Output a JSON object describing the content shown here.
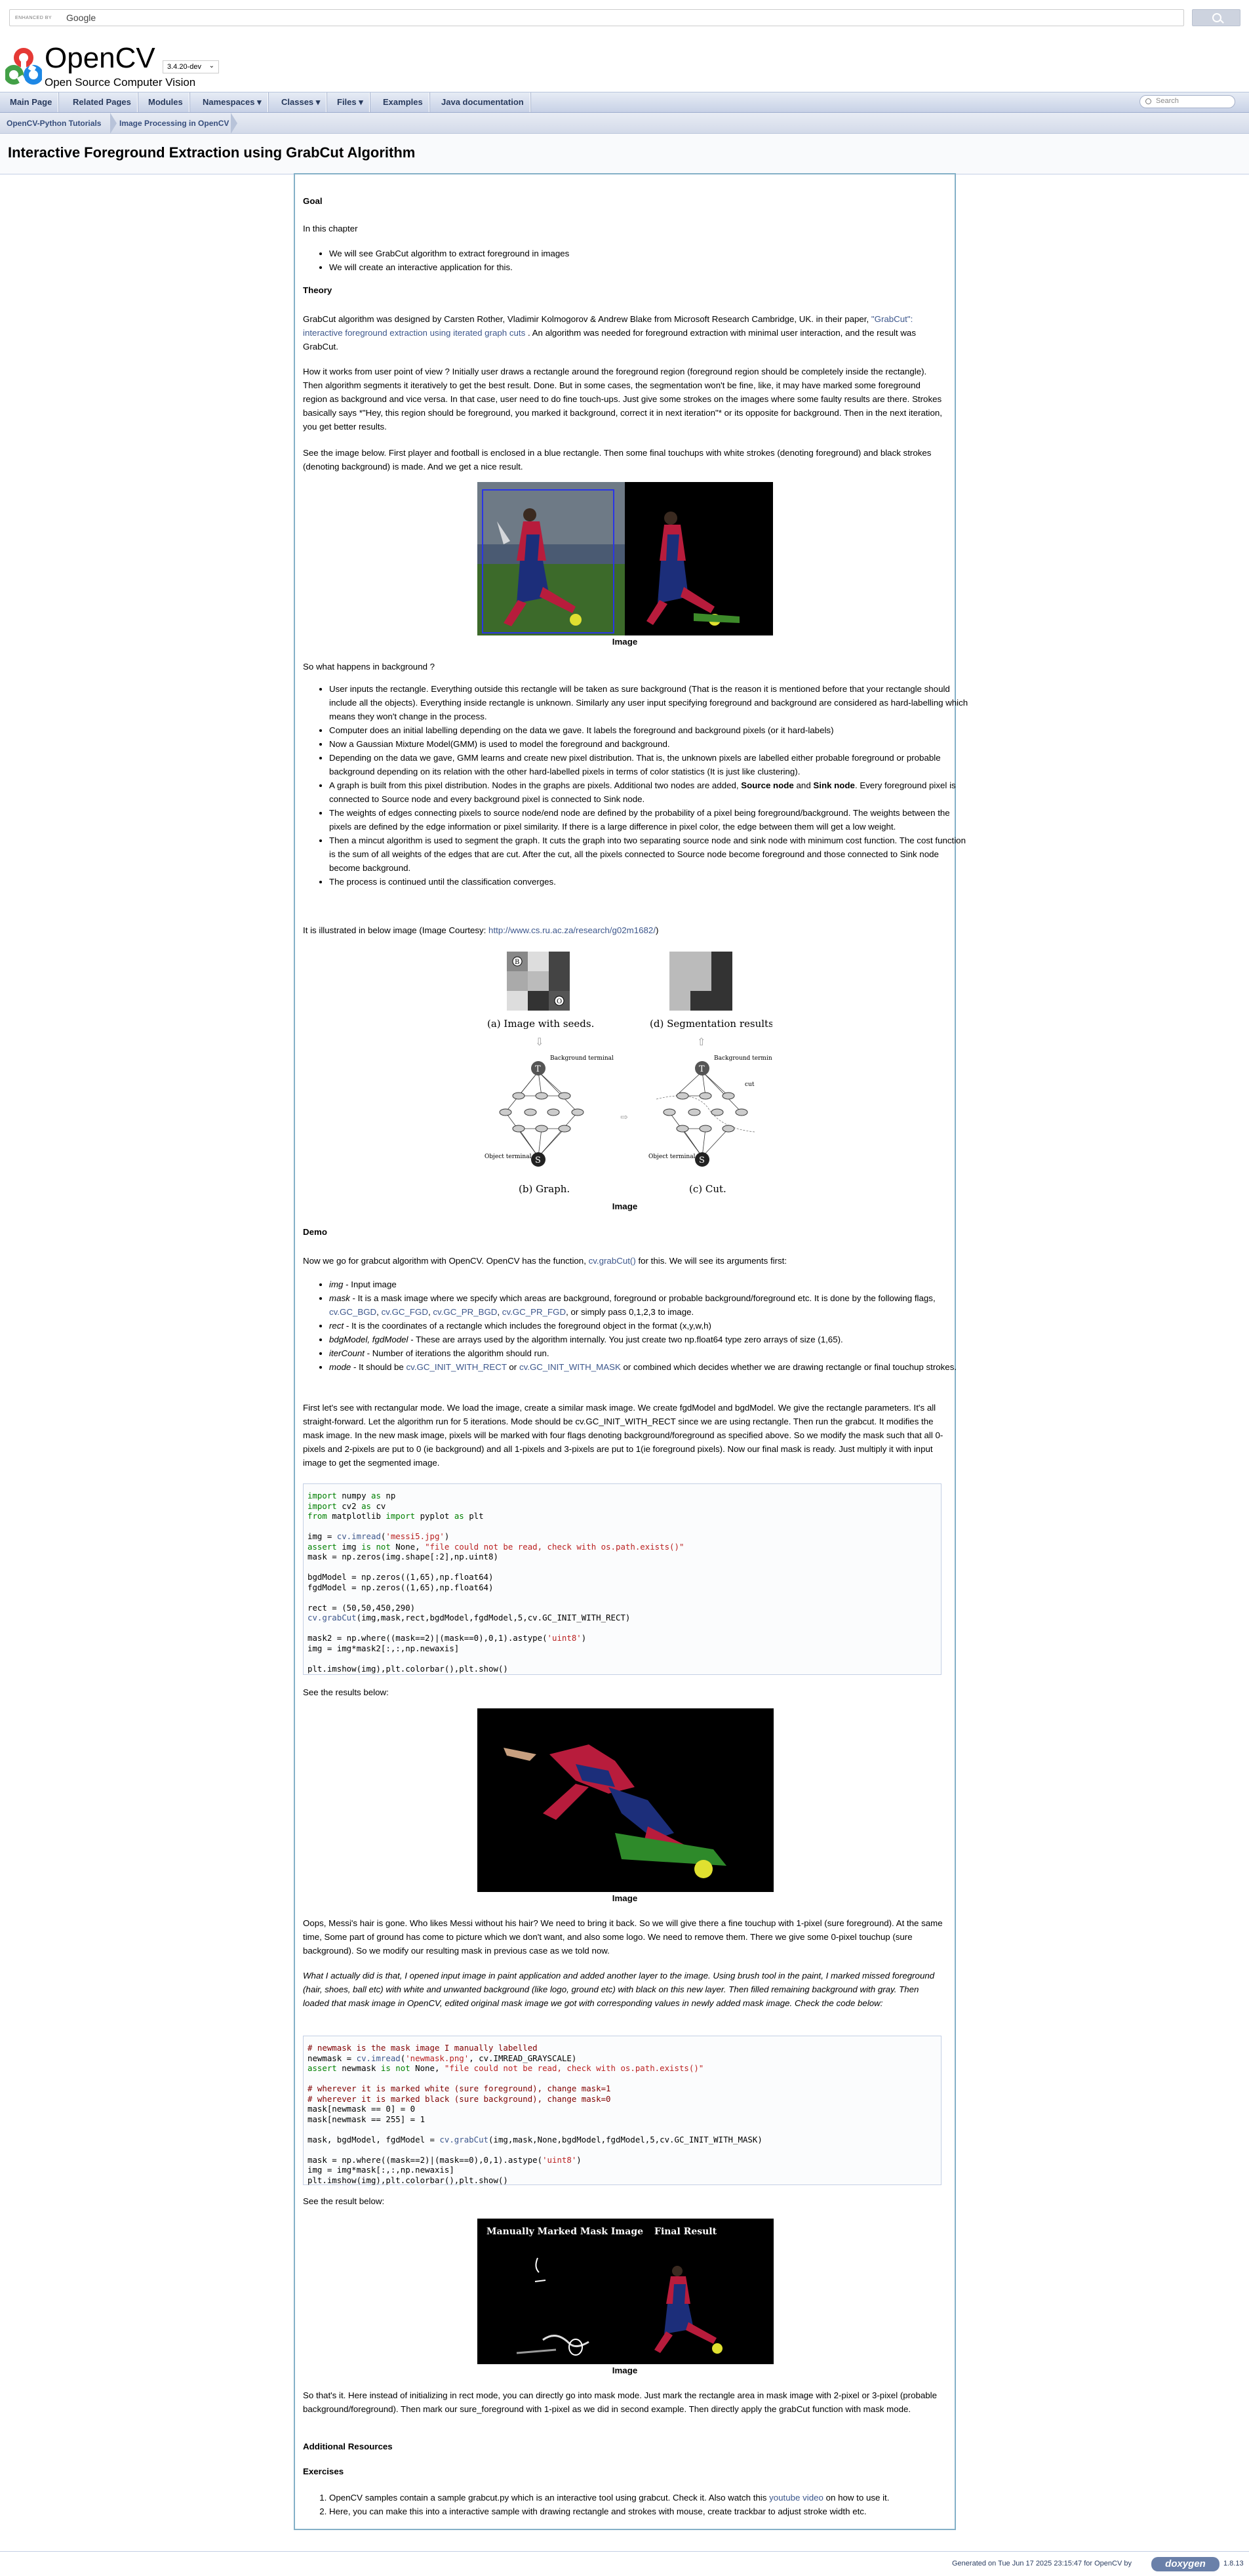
{
  "search": {
    "enhanced": "ENHANCED BY",
    "google": "Google",
    "nav_placeholder": "Search"
  },
  "header": {
    "project": "OpenCV",
    "brief": "Open Source Computer Vision",
    "version": "3.4.20-dev"
  },
  "navbar": [
    "Main Page",
    "Related Pages",
    "Modules",
    "Namespaces ▾",
    "Classes ▾",
    "Files ▾",
    "Examples",
    "Java documentation"
  ],
  "breadcrumb": [
    "OpenCV-Python Tutorials",
    "Image Processing in OpenCV"
  ],
  "page_title": "Interactive Foreground Extraction using GrabCut Algorithm",
  "goal": {
    "heading": "Goal",
    "intro": "In this chapter",
    "items": [
      "We will see GrabCut algorithm to extract foreground in images",
      "We will create an interactive application for this."
    ]
  },
  "theory": {
    "heading": "Theory",
    "p1_a": "GrabCut algorithm was designed by Carsten Rother, Vladimir Kolmogorov & Andrew Blake from Microsoft Research Cambridge, UK. in their paper, ",
    "p1_link": "\"GrabCut\": interactive foreground extraction using iterated graph cuts",
    "p1_b": " . An algorithm was needed for foreground extraction with minimal user interaction, and the result was GrabCut.",
    "p2": "How it works from user point of view ? Initially user draws a rectangle around the foreground region (foreground region should be completely inside the rectangle). Then algorithm segments it iteratively to get the best result. Done. But in some cases, the segmentation won't be fine, like, it may have marked some foreground region as background and vice versa. In that case, user need to do fine touch-ups. Just give some strokes on the images where some faulty results are there. Strokes basically says *\"Hey, this region should be foreground, you marked it background, correct it in next iteration\"* or its opposite for background. Then in the next iteration, you get better results.",
    "p3": "See the image below. First player and football is enclosed in a blue rectangle. Then some final touchups with white strokes (denoting foreground) and black strokes (denoting background) is made. And we get a nice result.",
    "caption1": "Image",
    "bg_q": "So what happens in background ?",
    "bullets": [
      "User inputs the rectangle. Everything outside this rectangle will be taken as sure background (That is the reason it is mentioned before that your rectangle should include all the objects). Everything inside rectangle is unknown. Similarly any user input specifying foreground and background are considered as hard-labelling which means they won't change in the process.",
      "Computer does an initial labelling depending on the data we gave. It labels the foreground and background pixels (or it hard-labels)",
      "Now a Gaussian Mixture Model(GMM) is used to model the foreground and background.",
      "Depending on the data we gave, GMM learns and create new pixel distribution. That is, the unknown pixels are labelled either probable foreground or probable background depending on its relation with the other hard-labelled pixels in terms of color statistics (It is just like clustering).",
      "The weights of edges connecting pixels to source node/end node are defined by the probability of a pixel being foreground/background. The weights between the pixels are defined by the edge information or pixel similarity. If there is a large difference in pixel color, the edge between them will get a low weight.",
      "Then a mincut algorithm is used to segment the graph. It cuts the graph into two separating source node and sink node with minimum cost function. The cost function is the sum of all weights of the edges that are cut. After the cut, all the pixels connected to Source node become foreground and those connected to Sink node become background.",
      "The process is continued until the classification converges."
    ],
    "bullet_graph_a": "A graph is built from this pixel distribution. Nodes in the graphs are pixels. Additional two nodes are added, ",
    "bullet_graph_source": "Source node",
    "bullet_graph_and": " and ",
    "bullet_graph_sink": "Sink node",
    "bullet_graph_b": ". Every foreground pixel is connected to Source node and every background pixel is connected to Sink node.",
    "illus_a": "It is illustrated in below image (Image Courtesy: ",
    "illus_link": "http://www.cs.ru.ac.za/research/g02m1682/",
    "illus_b": ")",
    "fig_labels": {
      "a": "(a) Image with seeds.",
      "d": "(d) Segmentation results.",
      "b": "(b) Graph.",
      "c": "(c) Cut.",
      "bg_term": "Background terminal",
      "obj_term": "Object terminal",
      "cut": "cut",
      "T": "T",
      "S": "S",
      "B": "B",
      "O": "O"
    },
    "caption2": "Image"
  },
  "demo": {
    "heading": "Demo",
    "p1_a": "Now we go for grabcut algorithm with OpenCV. OpenCV has the function, ",
    "p1_link": "cv.grabCut()",
    "p1_b": " for this. We will see its arguments first:",
    "args": [
      {
        "name": "img",
        "text": " - Input image"
      },
      {
        "name": "mask",
        "text": " - It is a mask image where we specify which areas are background, foreground or probable background/foreground etc. It is done by the following flags, ",
        "flags": [
          "cv.GC_BGD",
          "cv.GC_FGD",
          "cv.GC_PR_BGD",
          "cv.GC_PR_FGD"
        ],
        "tail": ", or simply pass 0,1,2,3 to image."
      },
      {
        "name": "rect",
        "text": " - It is the coordinates of a rectangle which includes the foreground object in the format (x,y,w,h)"
      },
      {
        "name": "bdgModel, fgdModel",
        "text": " - These are arrays used by the algorithm internally. You just create two np.float64 type zero arrays of size (1,65)."
      },
      {
        "name": "iterCount",
        "text": " - Number of iterations the algorithm should run."
      },
      {
        "name": "mode",
        "text": " - It should be ",
        "flags": [
          "cv.GC_INIT_WITH_RECT",
          "cv.GC_INIT_WITH_MASK"
        ],
        "tail": " or combined which decides whether we are drawing rectangle or final touchup strokes."
      }
    ],
    "p2": "First let's see with rectangular mode. We load the image, create a similar mask image. We create fgdModel and bgdModel. We give the rectangle parameters. It's all straight-forward. Let the algorithm run for 5 iterations. Mode should be cv.GC_INIT_WITH_RECT since we are using rectangle. Then run the grabcut. It modifies the mask image. In the new mask image, pixels will be marked with four flags denoting background/foreground as specified above. So we modify the mask such that all 0-pixels and 2-pixels are put to 0 (ie background) and all 1-pixels and 3-pixels are put to 1(ie foreground pixels). Now our final mask is ready. Just multiply it with input image to get the segmented image.",
    "results_below": "See the results below:",
    "caption3": "Image",
    "p3": "Oops, Messi's hair is gone. Who likes Messi without his hair? We need to bring it back. So we will give there a fine touchup with 1-pixel (sure foreground). At the same time, Some part of ground has come to picture which we don't want, and also some logo. We need to remove them. There we give some 0-pixel touchup (sure background). So we modify our resulting mask in previous case as we told now.",
    "p4": "What I actually did is that, I opened input image in paint application and added another layer to the image. Using brush tool in the paint, I marked missed foreground (hair, shoes, ball etc) with white and unwanted background (like logo, ground etc) with black on this new layer. Then filled remaining background with gray. Then loaded that mask image in OpenCV, edited original mask image we got with corresponding values in newly added mask image. Check the code below:",
    "result_below": "See the result below:",
    "fig4": {
      "left": "Manually Marked Mask Image",
      "right": "Final Result"
    },
    "caption4": "Image",
    "p5": "So that's it. Here instead of initializing in rect mode, you can directly go into mask mode. Just mark the rectangle area in mask image with 2-pixel or 3-pixel (probable background/foreground). Then mark our sure_foreground with 1-pixel as we did in second example. Then directly apply the grabCut function with mask mode."
  },
  "resources": {
    "heading": "Additional Resources"
  },
  "exercises": {
    "heading": "Exercises",
    "item1_a": "OpenCV samples contain a sample grabcut.py which is an interactive tool using grabcut. Check it. Also watch this ",
    "item1_link": "youtube video",
    "item1_b": " on how to use it.",
    "item2": "Here, you can make this into a interactive sample with drawing rectangle and strokes with mouse, create trackbar to adjust stroke width etc."
  },
  "footer": {
    "generated": "Generated on Tue Jun 17 2025 23:15:47 for OpenCV by",
    "brand": "doxygen",
    "version": "1.8.13"
  }
}
